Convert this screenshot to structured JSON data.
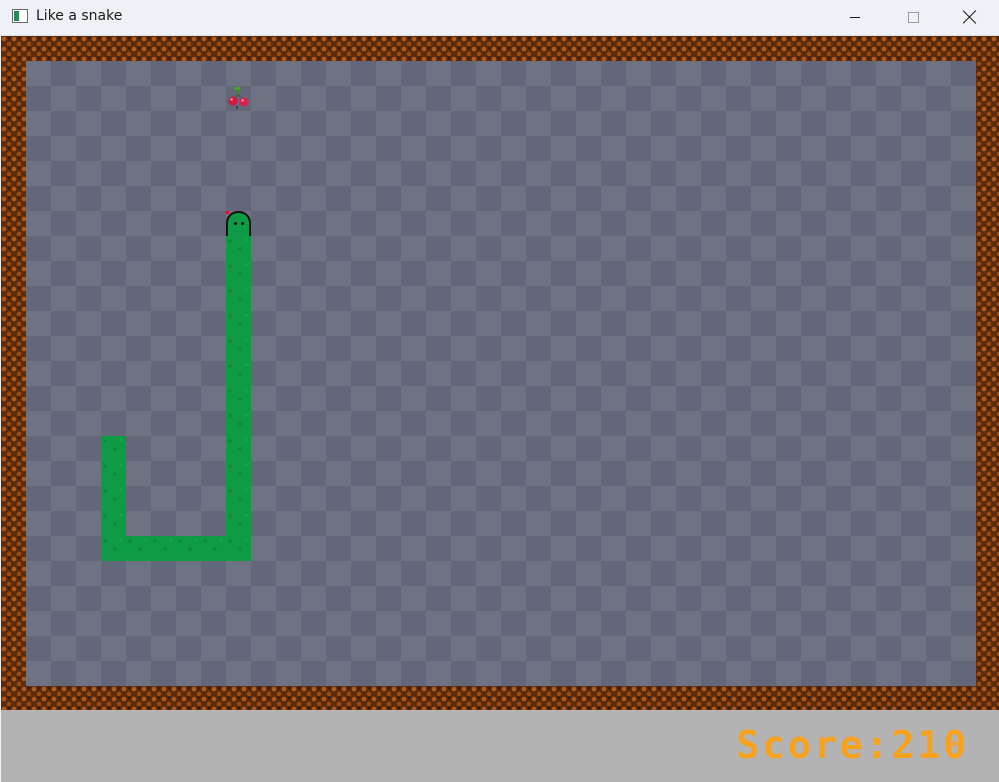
{
  "window": {
    "title": "Like a snake",
    "icon": "app-window-icon",
    "controls": [
      "minimize-icon",
      "maximize-icon",
      "close-icon"
    ]
  },
  "game": {
    "board_theme": "checkerboard",
    "border_theme": "brick",
    "snake_color": "#0f9a45",
    "food": "cherry-icon"
  },
  "status": {
    "score_text": "Score:210",
    "score_color": "#f7a21c"
  }
}
